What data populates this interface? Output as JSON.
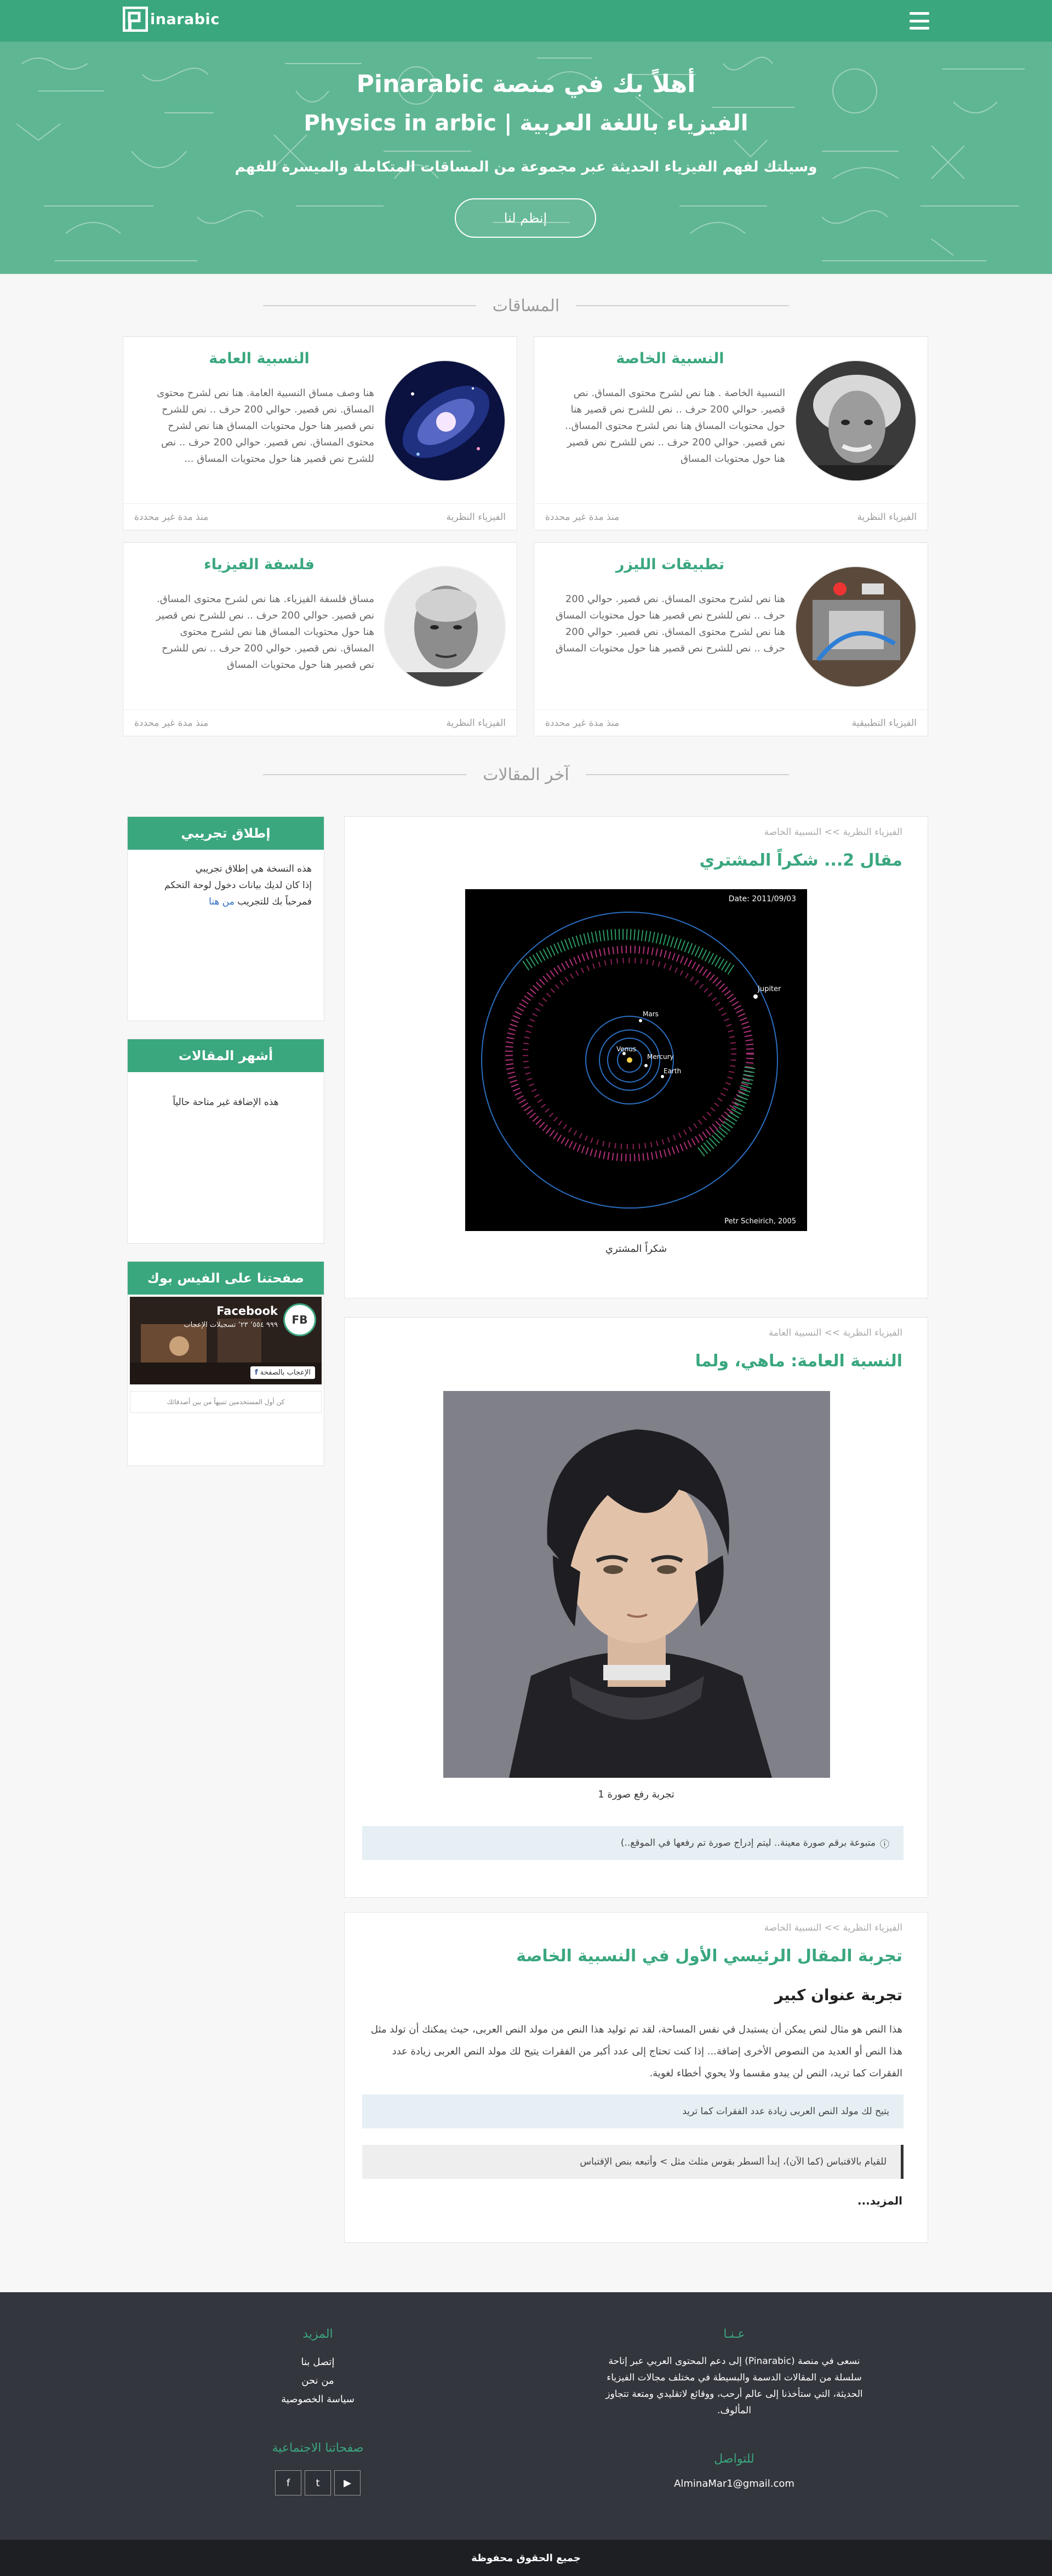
{
  "header": {
    "logo_text": "inarabic",
    "menu_icon": "hamburger-menu-icon"
  },
  "hero": {
    "title": "أهلاً بك في منصة Pinarabic",
    "subtitle": "Physics in arbic | الفيزياء باللغة العربية",
    "tagline": "وسيلتك لفهم الفيزياء الحديثة عبر مجموعة من المساقات المتكاملة والميسرة للفهم",
    "join_label": "إنظم لنا"
  },
  "courses_title": "المساقات",
  "courses": [
    {
      "title": "النسبية الخاصة",
      "desc": "النسبية الخاصة . هنا نص لشرح محتوى المساق. نص قصير. حوالي 200 حرف .. نص للشرح نص قصير هنا حول محتويات المساق هنا نص لشرح محتوى المساق.. نص قصير. حوالي 200 حرف .. نص للشرح نص قصير هنا حول محتويات المساق",
      "category": "الفيزياء النظرية",
      "time": "منذ مدة غير محددة",
      "image": "einstein-portrait"
    },
    {
      "title": "النسبية العامة",
      "desc": "هنا وصف مساق النسبية العامة. هنا نص لشرح محتوى المساق. نص قصير. حوالي 200 حرف .. نص للشرح نص قصير هنا حول محتويات المساق هنا نص لشرح محتوى المساق. نص قصير. حوالي 200 حرف .. نص للشرح نص قصير هنا حول محتويات المساق ...",
      "category": "الفيزياء النظرية",
      "time": "منذ مدة غير محددة",
      "image": "galaxy-spiral"
    },
    {
      "title": "تطبيقات الليزر",
      "desc": "هنا نص لشرح محتوى المساق. نص قصير. حوالي 200 حرف .. نص للشرح نص قصير هنا حول محتويات المساق هنا نص لشرح محتوى المساق. نص قصير. حوالي 200 حرف .. نص للشرح نص قصير هنا حول محتويات المساق",
      "category": "الفيزياء التطبيقية",
      "time": "منذ مدة غير محددة",
      "image": "laser-apparatus"
    },
    {
      "title": "فلسفة الفيزياء",
      "desc": "مساق فلسفة الفيزياء. هنا نص لشرح محتوى المساق. نص قصير. حوالي 200 حرف .. نص للشرح نص قصير هنا حول محتويات المساق هنا نص لشرح محتوى المساق. نص قصير. حوالي 200 حرف .. نص للشرح نص قصير هنا حول محتويات المساق",
      "category": "الفيزياء النظرية",
      "time": "منذ مدة غير محددة",
      "image": "philosopher-portrait"
    }
  ],
  "articles_title": "آخر المقالات",
  "sidebar": {
    "launch": {
      "title": "إطلاق تجريبي",
      "line1": "هذه النسخة هي إطلاق تجريبي",
      "line2": "إذا كان لديك بيانات دخول لوحة التحكم",
      "line3": "فمرحباً بك للتجريب",
      "link": "من هنا"
    },
    "popular": {
      "title": "أشهر المقالات",
      "text": "هذه الإضافة غير متاحة حالياً"
    },
    "facebook": {
      "title": "صفحتنا على الفيس بوك",
      "page_name": "Facebook",
      "followers": "٩٩٩ ٬٥٥٤ ٬٢٣ تسجيلات الإعجاب",
      "like_button": "الإعجاب بالصفحة",
      "fb_badge": "FB",
      "bottom": "كن أول المستخدمين تنبيهاً من بين أصدقائك"
    }
  },
  "posts": [
    {
      "crumb": "الفيزياء النظرية >> النسبية الخاصة",
      "title": "مقال 2... شكراً المشتري",
      "caption": "شكراً المشتري",
      "figure": {
        "date": "Date: 2011/09/03",
        "credit": "Petr Scheirich, 2005",
        "labels": [
          "Jupiter",
          "Mars",
          "Venus",
          "Mercury",
          "Earth"
        ]
      }
    },
    {
      "crumb": "الفيزياء النظرية >> النسبية العامة",
      "title": "النسبة العامة: ماهي، ولما",
      "caption": "تجربة رفع صورة 1",
      "note": "متبوعة برقم صورة معينة.. ليتم إدراج صورة تم رفعها في الموقع..)"
    },
    {
      "crumb": "الفيزياء النظرية >> النسبية الخاصة",
      "title": "تجربة المقال الرئيسي الأول في النسبية الخاصة",
      "heading": "تجربة عنوان كبير",
      "para": "هذا النص هو مثال لنص يمكن أن يستبدل في نفس المساحة، لقد تم توليد هذا النص من مولد النص العربى، حيث يمكنك أن تولد مثل هذا النص أو العديد من النصوص الأخرى إضافة... إذا كنت تحتاج إلى عدد أكبر من الفقرات يتيح لك مولد النص العربى زيادة عدد الفقرات كما تريد، النص لن يبدو مقسما ولا يحوي أخطاء لغوية.",
      "note": "يتيح لك مولد النص العربى زيادة عدد الفقرات كما تريد",
      "quote": "للقيام بالاقتباس (كما الآن)، إبدأ السطر بقوس مثلث مثل > وأتبعه بنص الإقتباس",
      "more": "المزيد..."
    }
  ],
  "footer": {
    "about_title": "عـنـا",
    "about_text": "نسعى في منصة (Pinarabic) إلى دعم المحتوى العربي عبر إتاحة سلسلة من المقالات الدسمة والبسيطة في مختلف مجالات الفيزياء الحديثة، التي ستأخذنا إلى عالم أرحب، ووقائع لاتقليدي ومتعة تتجاوز المألوف.",
    "more_title": "المزيد",
    "links": [
      "إتصل بنا",
      "من نحن",
      "سياسة الخصوصية"
    ],
    "contact_title": "للتواصل",
    "email": "AlminaMar1@gmail.com",
    "social_title": "صفحاتنا الاجتماعية",
    "social": [
      "f",
      "t",
      "▶"
    ],
    "copyright": "جميع الحقوق محفوظة"
  },
  "colors": {
    "brand": "#3aa77e",
    "footer": "#33363d"
  }
}
